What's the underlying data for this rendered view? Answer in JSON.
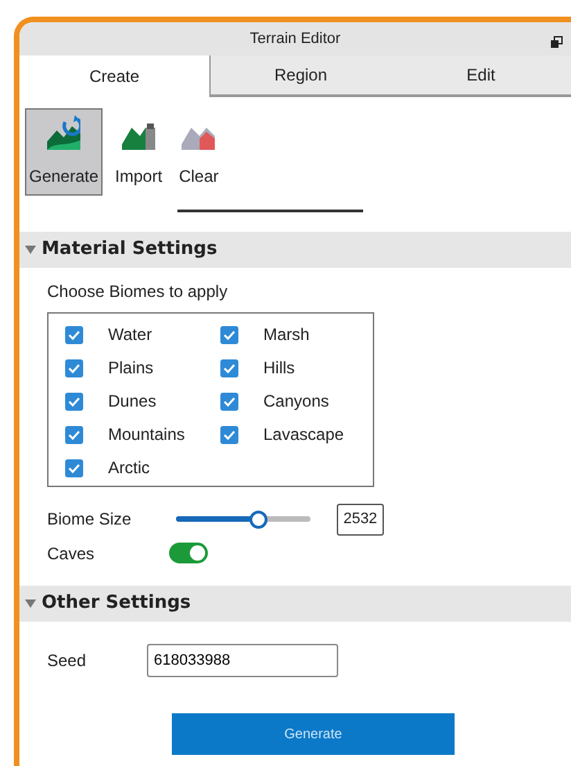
{
  "window": {
    "title": "Terrain Editor"
  },
  "tabs": [
    {
      "label": "Create",
      "selected": true
    },
    {
      "label": "Region",
      "selected": false
    },
    {
      "label": "Edit",
      "selected": false
    }
  ],
  "tools": [
    {
      "label": "Generate",
      "selected": true,
      "kind": "generate"
    },
    {
      "label": "Import",
      "selected": false,
      "kind": "import"
    },
    {
      "label": "Clear",
      "selected": false,
      "kind": "clear"
    }
  ],
  "material_settings": {
    "title": "Material Settings",
    "expanded": true,
    "biomes_label": "Choose Biomes to apply",
    "biomes": [
      {
        "label": "Water",
        "checked": true
      },
      {
        "label": "Marsh",
        "checked": true
      },
      {
        "label": "Plains",
        "checked": true
      },
      {
        "label": "Hills",
        "checked": true
      },
      {
        "label": "Dunes",
        "checked": true
      },
      {
        "label": "Canyons",
        "checked": true
      },
      {
        "label": "Mountains",
        "checked": true
      },
      {
        "label": "Lavascape",
        "checked": true
      },
      {
        "label": "Arctic",
        "checked": true
      }
    ],
    "biome_size": {
      "label": "Biome Size",
      "level": 0.62,
      "value": "2532"
    },
    "caves": {
      "label": "Caves",
      "on": true
    }
  },
  "other_settings": {
    "title": "Other Settings",
    "expanded": true,
    "seed": {
      "label": "Seed",
      "value": "618033988"
    }
  },
  "generate_button": "Generate"
}
